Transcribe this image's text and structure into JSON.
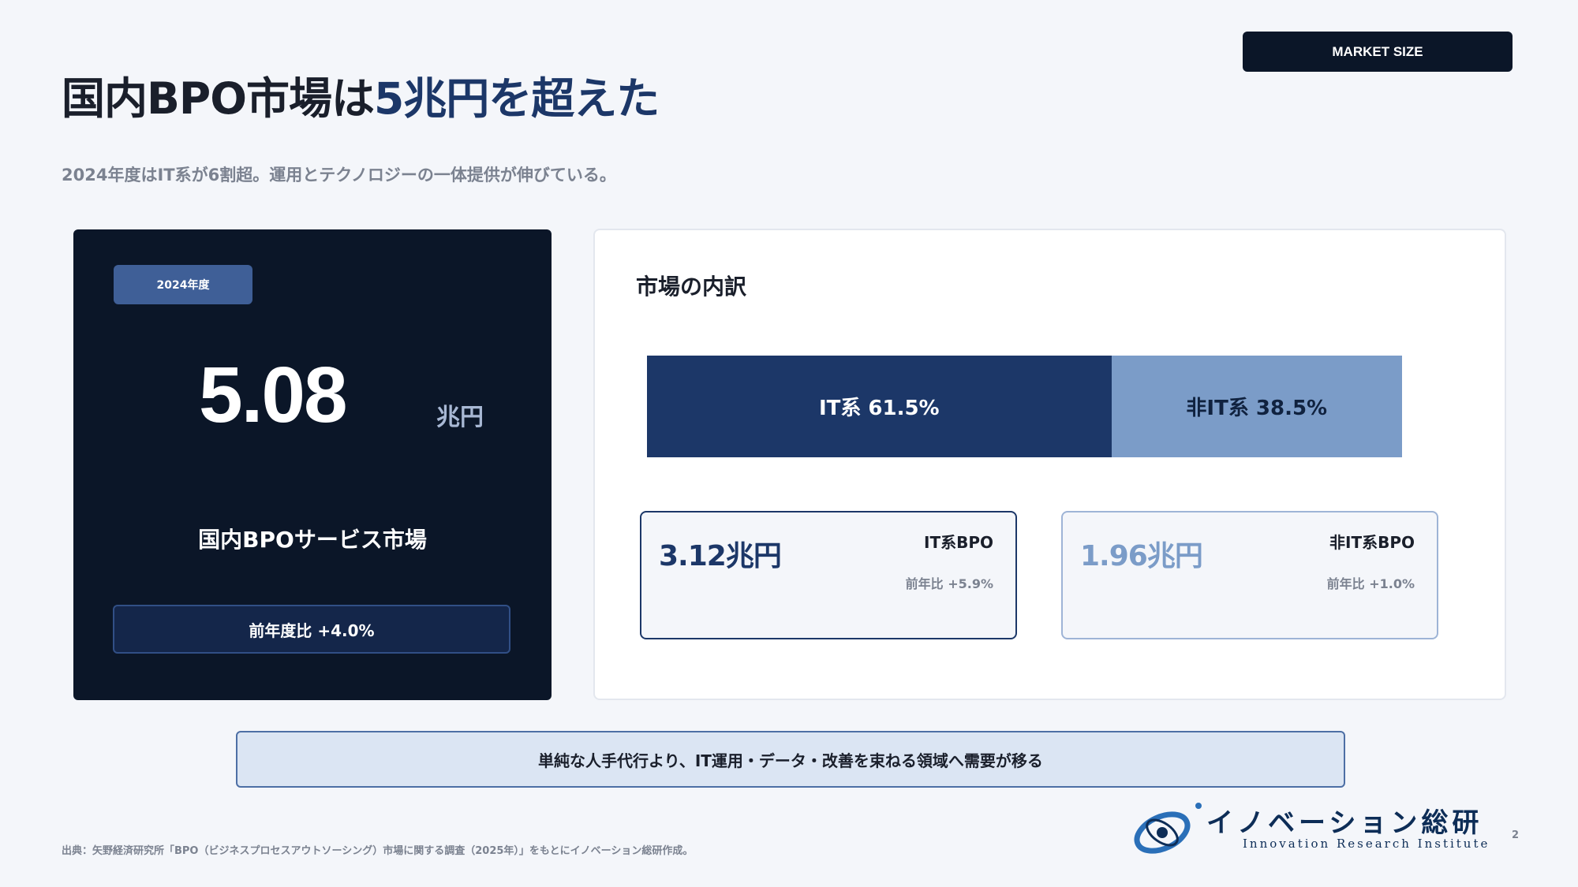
{
  "header": {
    "tag": "MARKET SIZE",
    "title_main": "国内BPO市場は",
    "title_highlight": "5兆円を超えた",
    "subtitle": "2024年度はIT系が6割超。運用とテクノロジーの一体提供が伸びている。"
  },
  "summary_card": {
    "year_label": "2024年度",
    "value": "5.08",
    "unit": "兆円",
    "market_name": "国内BPOサービス市場",
    "yoy": "前年度比 +4.0%"
  },
  "breakdown": {
    "title": "市場の内訳",
    "segments": [
      {
        "label": "IT系 61.5%",
        "share": 61.5,
        "color": "#1c3768"
      },
      {
        "label": "非IT系 38.5%",
        "share": 38.5,
        "color": "#7b9cc8"
      }
    ],
    "cards": [
      {
        "value": "3.12兆円",
        "name": "IT系BPO",
        "yoy": "前年比 +5.9%"
      },
      {
        "value": "1.96兆円",
        "name": "非IT系BPO",
        "yoy": "前年比 +1.0%"
      }
    ]
  },
  "message": "単純な人手代行より、IT運用・データ・改善を束ねる領域へ需要が移る",
  "footer": {
    "source": "出典：矢野経済研究所「BPO（ビジネスプロセスアウトソーシング）市場に関する調査（2025年）」をもとにイノベーション総研作成。",
    "logo_jp": "イノベーション総研",
    "logo_en": "Innovation Research Institute",
    "page_number": "2"
  },
  "colors": {
    "navy": "#0b1628",
    "primary": "#1c3768",
    "secondary": "#7b9cc8",
    "background": "#f4f6fa"
  }
}
